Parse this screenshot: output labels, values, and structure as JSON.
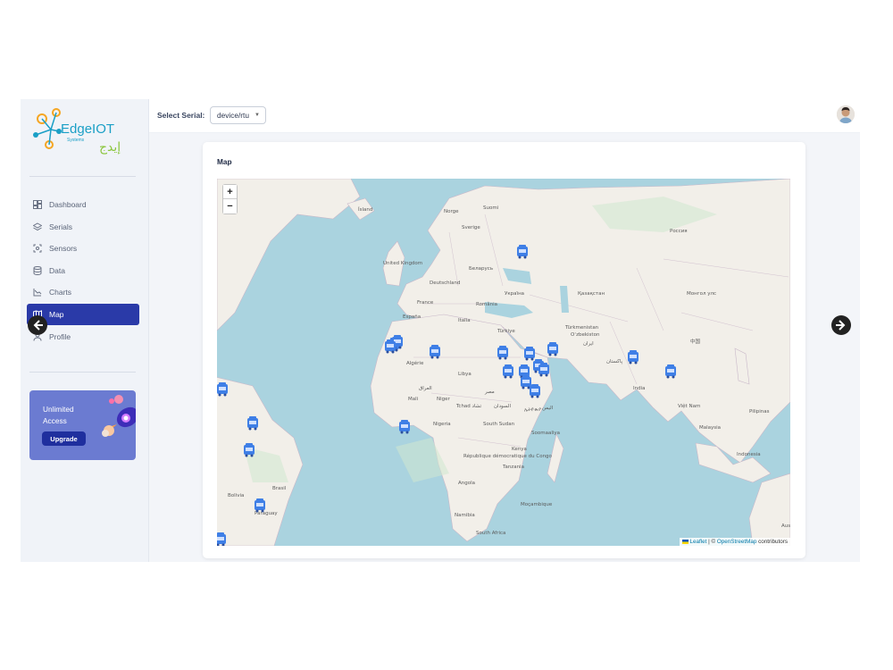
{
  "brand": {
    "name_en": "EdgeIOT",
    "name_ar": "إيدج",
    "tagline": "Systems"
  },
  "sidebar": {
    "items": [
      {
        "label": "Dashboard",
        "icon": "dashboard-icon",
        "active": false
      },
      {
        "label": "Serials",
        "icon": "layers-icon",
        "active": false
      },
      {
        "label": "Sensors",
        "icon": "sensor-icon",
        "active": false
      },
      {
        "label": "Data",
        "icon": "database-icon",
        "active": false
      },
      {
        "label": "Charts",
        "icon": "chart-icon",
        "active": false
      },
      {
        "label": "Map",
        "icon": "map-icon",
        "active": true
      },
      {
        "label": "Profile",
        "icon": "user-icon",
        "active": false
      }
    ],
    "upgrade": {
      "text": "Unlimited Access",
      "button": "Upgrade"
    }
  },
  "topbar": {
    "serial_label": "Select Serial:",
    "serial_value": "device/rtu"
  },
  "map_card": {
    "title": "Map",
    "zoom_in": "+",
    "zoom_out": "−",
    "attribution": {
      "leaflet": "Leaflet",
      "sep": " | © ",
      "osm": "OpenStreetMap",
      "suffix": " contributors"
    },
    "labels": [
      "Ísland",
      "Norge",
      "Sverige",
      "Suomi",
      "Россия",
      "United Kingdom",
      "Deutschland",
      "Беларусь",
      "Україна",
      "France",
      "România",
      "Italia",
      "España",
      "Türkiye",
      "Қазақстан",
      "Монгол улс",
      "Oʻzbekiston",
      "Türkmenistan",
      "中国",
      "پاکستان",
      "India",
      "Algérie",
      "Libya",
      "Mali",
      "Niger",
      "Tchad تشاد",
      "Nigeria",
      "السودان",
      "South Sudan",
      "Soomaaliya",
      "Kenya",
      "République démocratique du Congo",
      "Tanzania",
      "Angola",
      "Namibia",
      "South Africa",
      "Moçambique",
      "Brasil",
      "Bolivia",
      "Paraguay",
      "Việt Nam",
      "Pilipinas",
      "Indonesia",
      "Malaysia",
      "Aust",
      "العراق",
      "مصر",
      "اليمن",
      "ایران",
      "ኢትዮጵያ"
    ]
  },
  "colors": {
    "accent": "#2a3aa8",
    "marker": "#3f7fe6",
    "water": "#aad3df",
    "land": "#f2efe9"
  }
}
